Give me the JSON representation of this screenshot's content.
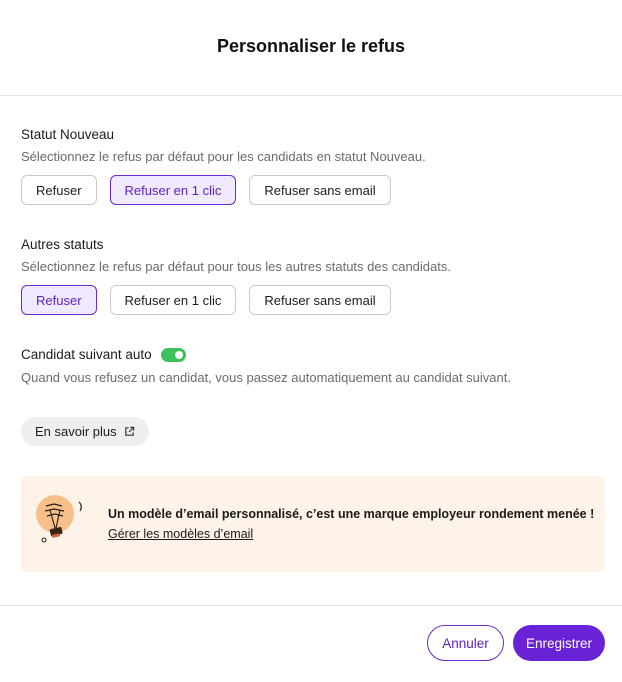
{
  "modal": {
    "title": "Personnaliser le refus"
  },
  "statut_nouveau": {
    "title": "Statut Nouveau",
    "description": "Sélectionnez le refus par défaut pour les candidats en statut Nouveau.",
    "options": [
      "Refuser",
      "Refuser en 1 clic",
      "Refuser sans email"
    ],
    "selected": "Refuser en 1 clic"
  },
  "autres_statuts": {
    "title": "Autres statuts",
    "description": "Sélectionnez le refus par défaut pour tous les autres statuts des candidats.",
    "options": [
      "Refuser",
      "Refuser en 1 clic",
      "Refuser sans email"
    ],
    "selected": "Refuser"
  },
  "auto_next": {
    "title": "Candidat suivant auto",
    "enabled": true,
    "description": "Quand vous refusez un candidat, vous passez automatiquement au candidat suivant."
  },
  "learn_more": {
    "label": "En savoir plus",
    "icon": "external-link-icon"
  },
  "promo": {
    "title": "Un modèle d’email personnalisé, c’est une marque employeur rondement menée !",
    "link": "Gérer les modèles d’email",
    "illustration": "lightbulb-illustration"
  },
  "footer": {
    "cancel_label": "Annuler",
    "save_label": "Enregistrer"
  },
  "colors": {
    "accent": "#6a22d6",
    "selected_bg": "#f1e9fd",
    "toggle_on": "#3cc15b",
    "promo_bg": "#fef3e8"
  }
}
